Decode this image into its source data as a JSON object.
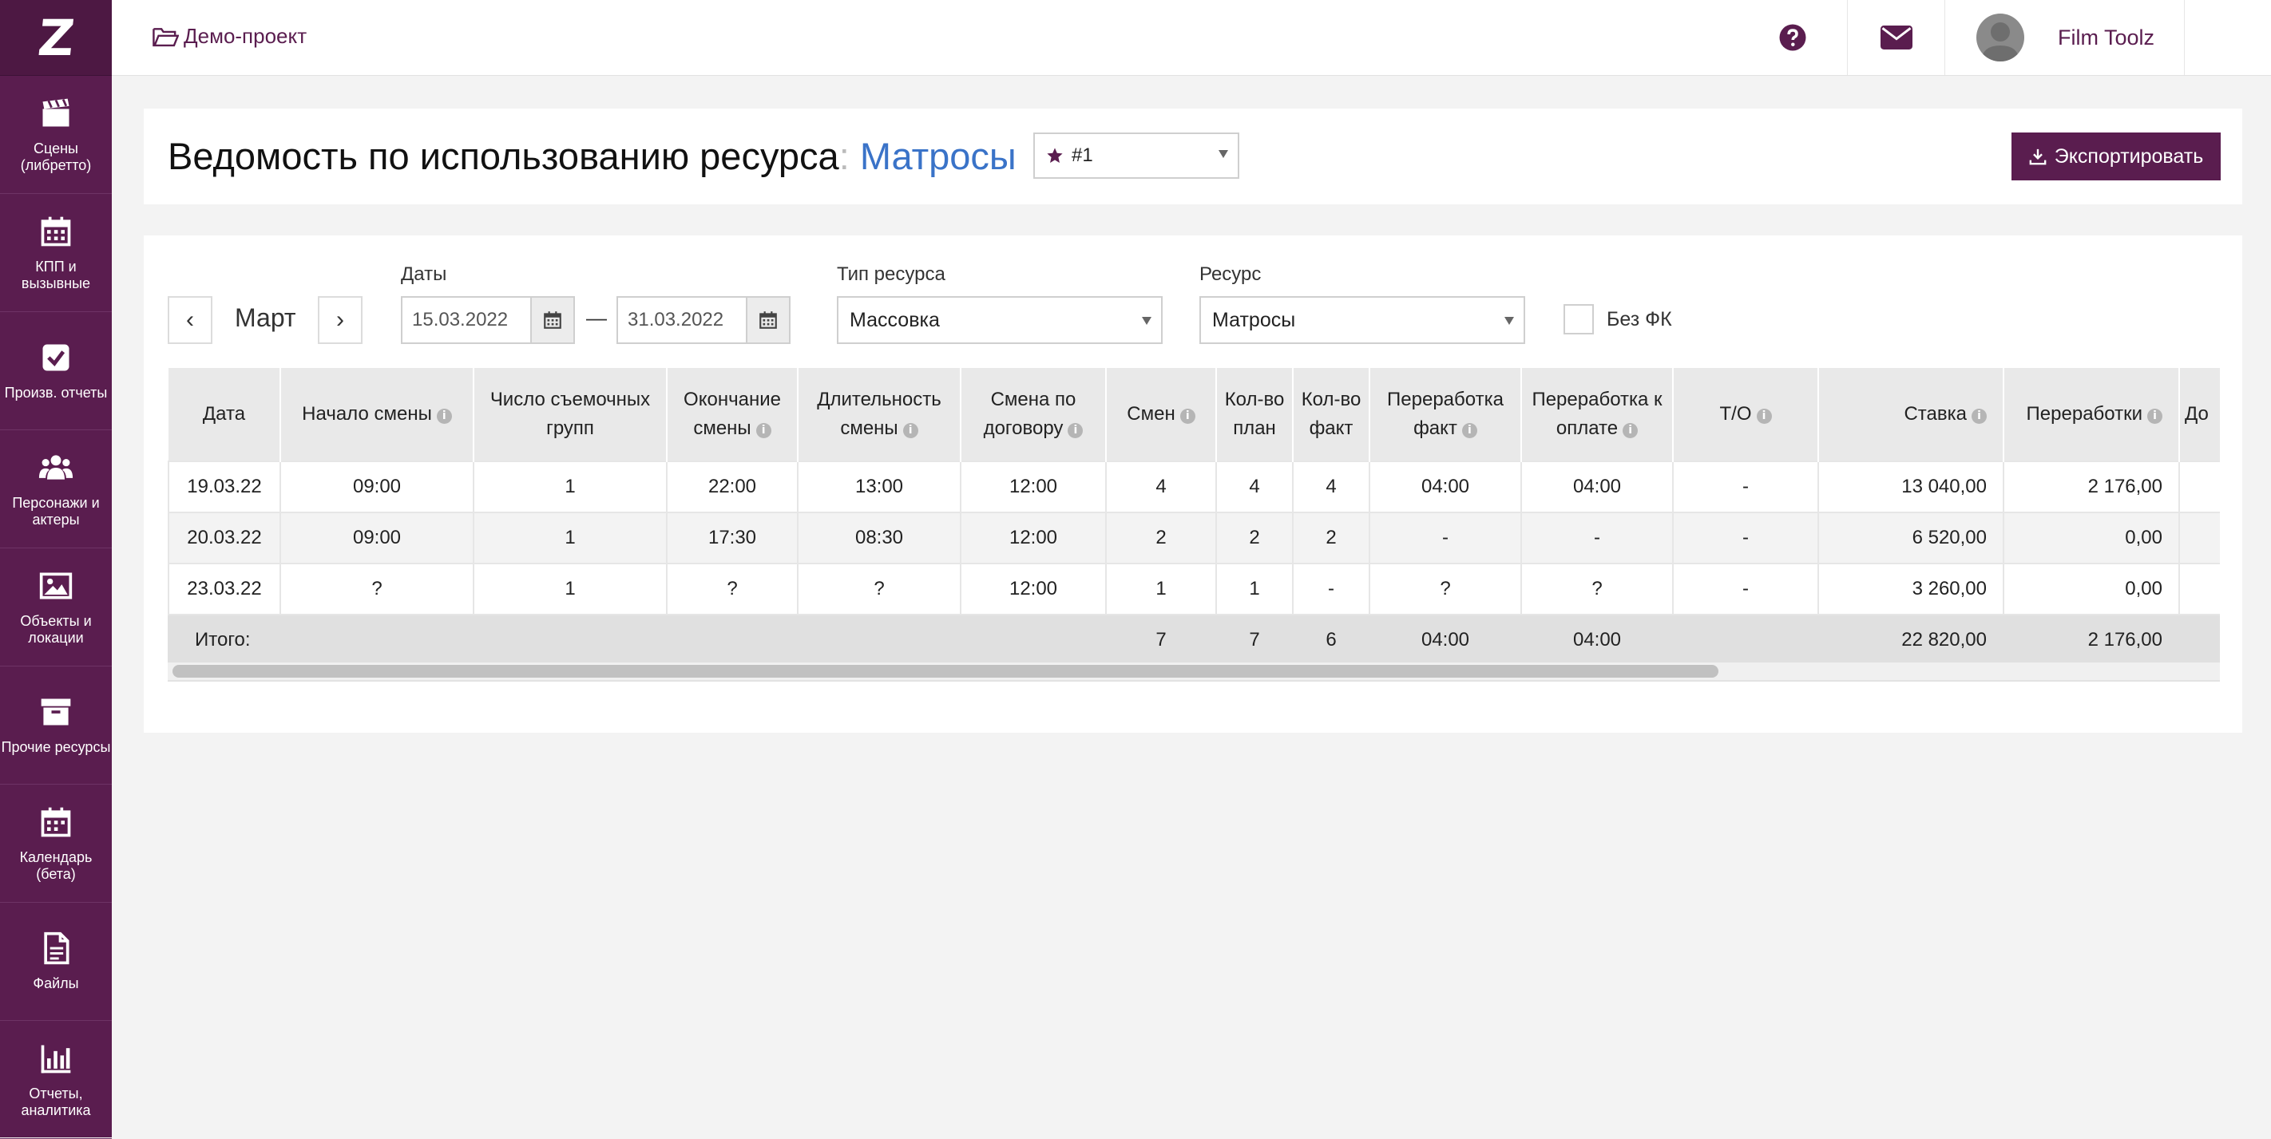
{
  "sidebar": {
    "logo": "Z",
    "items": [
      {
        "label": "Сцены (либретто)",
        "icon": "clapperboard-icon"
      },
      {
        "label": "КПП и вызывные",
        "icon": "calendar-icon"
      },
      {
        "label": "Произв. отчеты",
        "icon": "checkbox-icon"
      },
      {
        "label": "Персонажи и актеры",
        "icon": "users-icon"
      },
      {
        "label": "Объекты и локации",
        "icon": "image-icon"
      },
      {
        "label": "Прочие ресурсы",
        "icon": "archive-icon"
      },
      {
        "label": "Календарь (бета)",
        "icon": "calendar-grid-icon"
      },
      {
        "label": "Файлы",
        "icon": "file-icon"
      },
      {
        "label": "Отчеты, аналитика",
        "icon": "bar-chart-icon"
      }
    ]
  },
  "topbar": {
    "project": "Демо-проект",
    "user_name": "Film Toolz",
    "lang": "RU"
  },
  "header": {
    "title_prefix": "Ведомость по использованию ресурса",
    "colon": ":",
    "resource_name": "Матросы",
    "variant": "#1",
    "export_label": "Экспортировать"
  },
  "filters": {
    "prev": "‹",
    "next": "›",
    "month": "Март",
    "dates_label": "Даты",
    "date_from": "15.03.2022",
    "dash": "—",
    "date_to": "31.03.2022",
    "resource_type_label": "Тип ресурса",
    "resource_type": "Массовка",
    "resource_label": "Ресурс",
    "resource": "Матросы",
    "no_fk_label": "Без ФК"
  },
  "table": {
    "columns": [
      {
        "label": "Дата",
        "info": false
      },
      {
        "label": "Начало смены",
        "info": true
      },
      {
        "label": "Число съемочных групп",
        "info": false
      },
      {
        "label": "Окончание смены",
        "info": true
      },
      {
        "label": "Длительность смены",
        "info": true
      },
      {
        "label": "Смена по договору",
        "info": true
      },
      {
        "label": "Смен",
        "info": true
      },
      {
        "label": "Кол-во план",
        "info": false
      },
      {
        "label": "Кол-во факт",
        "info": false
      },
      {
        "label": "Переработка факт",
        "info": true
      },
      {
        "label": "Переработка к оплате",
        "info": true
      },
      {
        "label": "Т/О",
        "info": true
      },
      {
        "label": "Ставка",
        "info": true
      },
      {
        "label": "Переработки",
        "info": true
      },
      {
        "label": "До",
        "info": false
      }
    ],
    "rows": [
      [
        "19.03.22",
        "09:00",
        "1",
        "22:00",
        "13:00",
        "12:00",
        "4",
        "4",
        "4",
        "04:00",
        "04:00",
        "-",
        "13 040,00",
        "2 176,00",
        ""
      ],
      [
        "20.03.22",
        "09:00",
        "1",
        "17:30",
        "08:30",
        "12:00",
        "2",
        "2",
        "2",
        "-",
        "-",
        "-",
        "6 520,00",
        "0,00",
        ""
      ],
      [
        "23.03.22",
        "?",
        "1",
        "?",
        "?",
        "12:00",
        "1",
        "1",
        "-",
        "?",
        "?",
        "-",
        "3 260,00",
        "0,00",
        ""
      ]
    ],
    "total": {
      "label": "Итого:",
      "shifts": "7",
      "plan": "7",
      "fact": "6",
      "overtime_fact": "04:00",
      "overtime_pay": "04:00",
      "rate": "22 820,00",
      "overtime": "2 176,00"
    }
  },
  "colors": {
    "brand": "#5a1d4f",
    "link": "#3a73c8"
  }
}
